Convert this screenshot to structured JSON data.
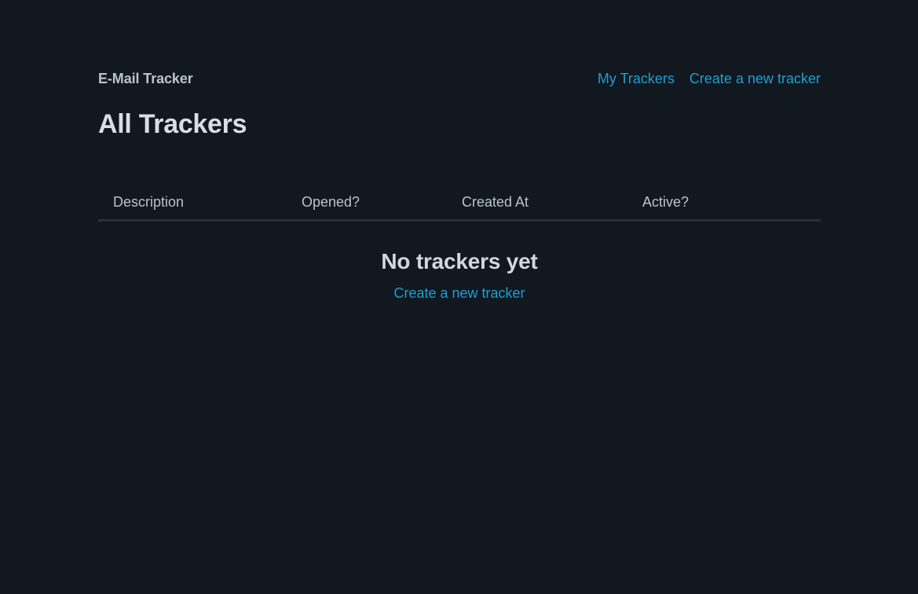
{
  "header": {
    "brand": "E-Mail Tracker",
    "nav": [
      {
        "label": "My Trackers"
      },
      {
        "label": "Create a new tracker"
      }
    ]
  },
  "main": {
    "title": "All Trackers",
    "table": {
      "columns": [
        "Description",
        "Opened?",
        "Created At",
        "Active?"
      ],
      "rows": []
    },
    "empty_state": {
      "title": "No trackers yet",
      "link_label": "Create a new tracker"
    }
  },
  "colors": {
    "background": "#111820",
    "link": "#1f9fd0",
    "divider": "#283139"
  }
}
